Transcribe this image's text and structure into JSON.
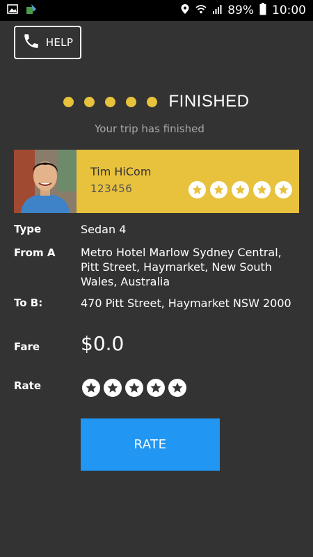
{
  "statusbar": {
    "battery": "89%",
    "time": "10:00"
  },
  "header": {
    "help_label": "HELP"
  },
  "progress": {
    "status": "FINISHED",
    "message": "Your trip has finished",
    "step_count": 5
  },
  "driver": {
    "name": "Tim HiCom",
    "id": "123456",
    "rating": 5
  },
  "details": {
    "type_label": "Type",
    "type_value": "Sedan 4",
    "from_label": "From A",
    "from_value": "Metro Hotel Marlow Sydney Central, Pitt Street, Haymarket, New South Wales, Australia",
    "to_label": "To B:",
    "to_value": "470 Pitt Street, Haymarket NSW 2000",
    "fare_label": "Fare",
    "fare_value": "$0.0",
    "rate_label": "Rate"
  },
  "actions": {
    "rate_button": "RATE"
  },
  "colors": {
    "accent": "#e8c13d",
    "background": "#333333",
    "button": "#2196f3"
  }
}
